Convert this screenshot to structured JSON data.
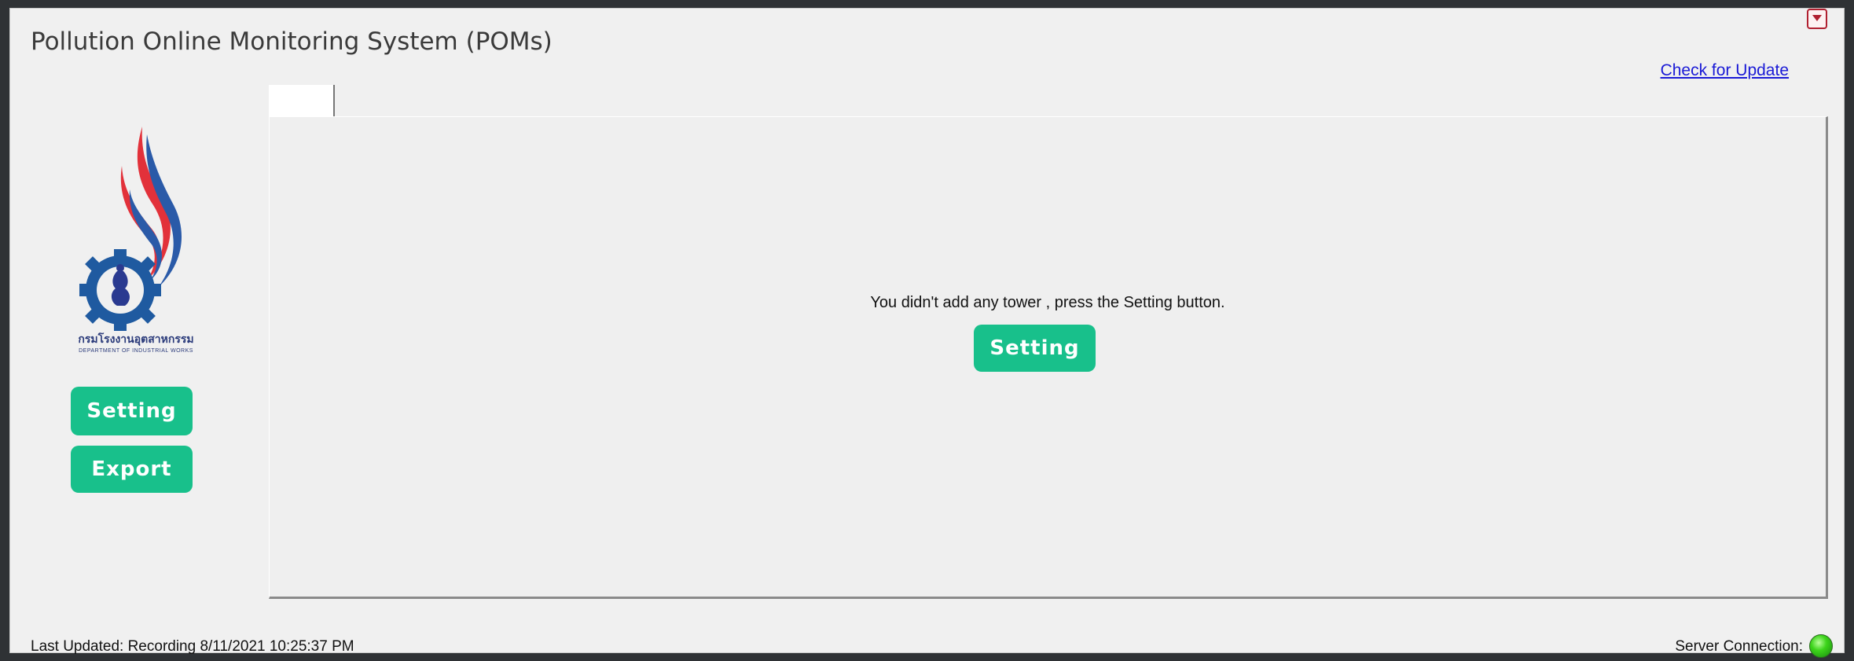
{
  "app": {
    "title": "Pollution Online Monitoring System (POMs)"
  },
  "header": {
    "check_update_label": "Check for Update",
    "menu_icon": "chevron-down-icon"
  },
  "sidebar": {
    "logo_text": "กรมโรงงานอุตสาหกรรม",
    "logo_subtext": "DEPARTMENT OF INDUSTRIAL WORKS",
    "setting_label": "Setting",
    "export_label": "Export"
  },
  "main": {
    "tab_label": "",
    "empty_message": "You didn't add any tower , press the Setting button.",
    "setting_label": "Setting"
  },
  "status_bar": {
    "last_updated": "Last Updated: Recording 8/11/2021 10:25:37 PM",
    "server_label": "Server Connection:",
    "server_status_color": "#3cd41a"
  },
  "colors": {
    "accent_button": "#18c08b",
    "link": "#1a1ad6"
  }
}
